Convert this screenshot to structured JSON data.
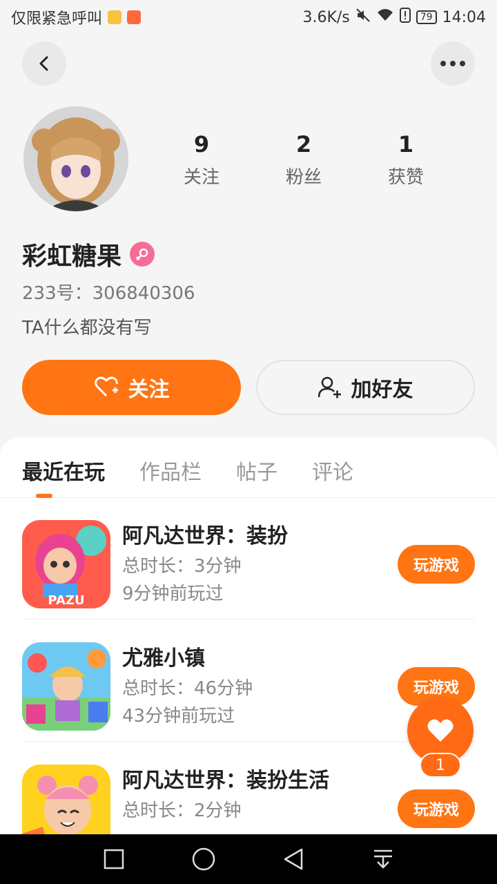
{
  "status_bar": {
    "carrier": "仅限紧急呼叫",
    "speed": "3.6K/s",
    "battery": "79",
    "time": "14:04"
  },
  "profile": {
    "stats": [
      {
        "num": "9",
        "label": "关注"
      },
      {
        "num": "2",
        "label": "粉丝"
      },
      {
        "num": "1",
        "label": "获赞"
      }
    ],
    "username": "彩虹糖果",
    "uid": "233号：306840306",
    "bio": "TA什么都没有写",
    "follow_label": "关注",
    "add_friend_label": "加好友"
  },
  "tabs": [
    "最近在玩",
    "作品栏",
    "帖子",
    "评论"
  ],
  "games": [
    {
      "name": "阿凡达世界：装扮",
      "duration": "总时长：3分钟",
      "last_played": "9分钟前玩过",
      "button": "玩游戏",
      "icon": "pazu-game-icon"
    },
    {
      "name": "尤雅小镇",
      "duration": "总时长：46分钟",
      "last_played": "43分钟前玩过",
      "button": "玩游戏",
      "icon": "town-game-icon"
    },
    {
      "name": "阿凡达世界：装扮生活",
      "duration": "总时长：2分钟",
      "last_played": "",
      "button": "玩游戏",
      "icon": "avatar-life-game-icon"
    }
  ],
  "fab": {
    "count": "1"
  },
  "colors": {
    "accent": "#ff7413",
    "background": "#f5f5f5"
  }
}
